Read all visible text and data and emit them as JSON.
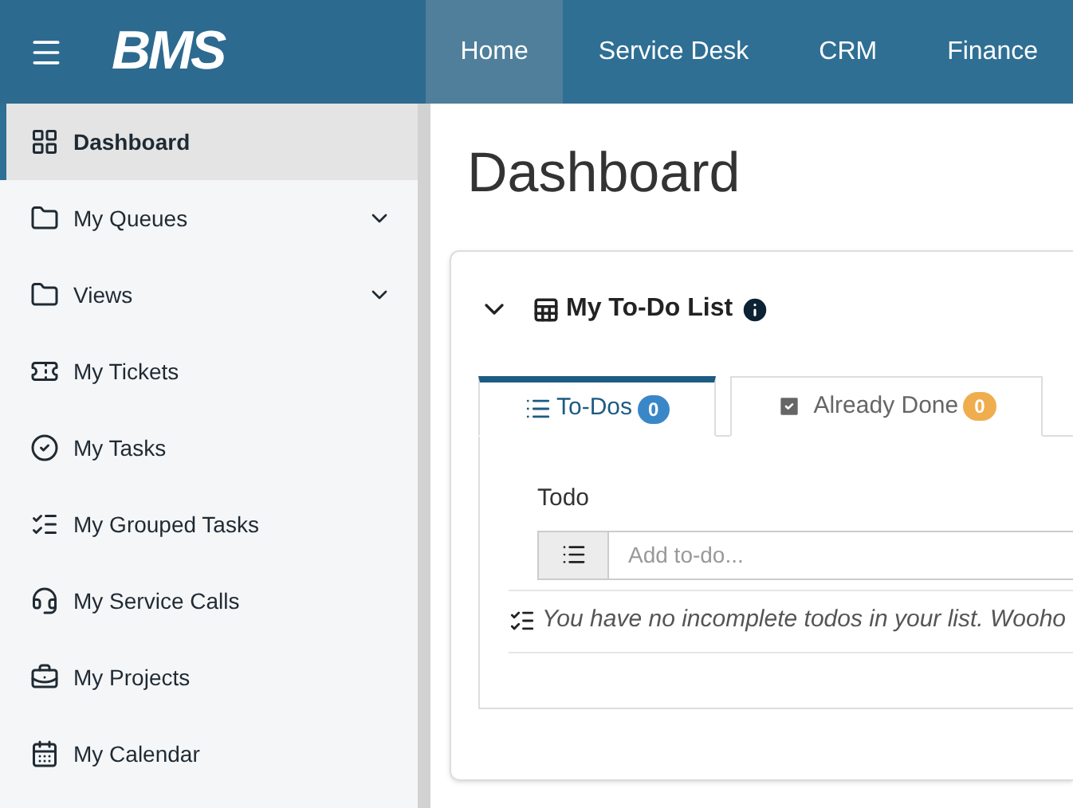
{
  "header": {
    "logo": "BMS",
    "nav": [
      {
        "label": "Home",
        "selected": true
      },
      {
        "label": "Service Desk",
        "selected": false
      },
      {
        "label": "CRM",
        "selected": false
      },
      {
        "label": "Finance",
        "selected": false
      }
    ]
  },
  "sidebar": {
    "items": [
      {
        "label": "Dashboard",
        "kind": "grid",
        "selected": true,
        "expandable": false
      },
      {
        "label": "My Queues",
        "kind": "folder",
        "selected": false,
        "expandable": true
      },
      {
        "label": "Views",
        "kind": "folder",
        "selected": false,
        "expandable": true
      },
      {
        "label": "My Tickets",
        "kind": "ticket",
        "selected": false,
        "expandable": false
      },
      {
        "label": "My Tasks",
        "kind": "check",
        "selected": false,
        "expandable": false
      },
      {
        "label": "My Grouped Tasks",
        "kind": "listcheck",
        "selected": false,
        "expandable": false
      },
      {
        "label": "My Service Calls",
        "kind": "headset",
        "selected": false,
        "expandable": false
      },
      {
        "label": "My Projects",
        "kind": "briefcase",
        "selected": false,
        "expandable": false
      },
      {
        "label": "My Calendar",
        "kind": "calendar",
        "selected": false,
        "expandable": false
      }
    ]
  },
  "page": {
    "title": "Dashboard"
  },
  "todo_card": {
    "title": "My To-Do List",
    "expanded": true,
    "tabs": [
      {
        "label": "To-Dos",
        "count": "0",
        "color": "#3a87c8",
        "kind": "list",
        "selected": true
      },
      {
        "label": "Already Done",
        "count": "0",
        "color": "#f0ad4e",
        "kind": "checkbox",
        "selected": false
      }
    ],
    "field_label": "Todo",
    "placeholder": "Add to-do...",
    "empty_message": "You have no incomplete todos in your list. Wooho"
  }
}
